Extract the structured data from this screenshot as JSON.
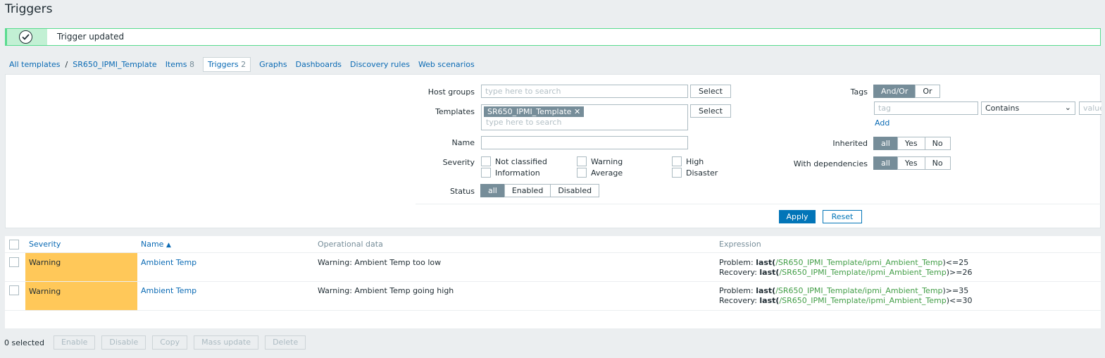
{
  "page": {
    "title": "Triggers"
  },
  "message": {
    "text": "Trigger updated"
  },
  "nav": {
    "all_templates": "All templates",
    "separator": "/",
    "template": "SR650_IPMI_Template",
    "items_label": "Items",
    "items_count": "8",
    "triggers_label": "Triggers",
    "triggers_count": "2",
    "graphs": "Graphs",
    "dashboards": "Dashboards",
    "discovery_rules": "Discovery rules",
    "web_scenarios": "Web scenarios"
  },
  "filter": {
    "host_groups_label": "Host groups",
    "host_groups_placeholder": "type here to search",
    "templates_label": "Templates",
    "templates_chip": "SR650_IPMI_Template",
    "templates_placeholder": "type here to search",
    "select_label": "Select",
    "name_label": "Name",
    "name_value": "",
    "severity_label": "Severity",
    "severities": [
      "Not classified",
      "Information",
      "Warning",
      "Average",
      "High",
      "Disaster"
    ],
    "status_label": "Status",
    "status_options": [
      "all",
      "Enabled",
      "Disabled"
    ],
    "status_selected": "all",
    "tags_label": "Tags",
    "tags_options": [
      "And/Or",
      "Or"
    ],
    "tag_placeholder": "tag",
    "tag_operator": "Contains",
    "value_placeholder": "value",
    "add_label": "Add",
    "inherited_label": "Inherited",
    "inherited_options": [
      "all",
      "Yes",
      "No"
    ],
    "dependencies_label": "With dependencies",
    "dependencies_options": [
      "all",
      "Yes",
      "No"
    ],
    "apply_label": "Apply",
    "reset_label": "Reset"
  },
  "table": {
    "headers": {
      "severity": "Severity",
      "name": "Name",
      "sort_indicator": "▲",
      "operational_data": "Operational data",
      "expression": "Expression"
    },
    "rows": [
      {
        "severity": "Warning",
        "name": "Ambient Temp",
        "operational_data": "Warning: Ambient Temp too low",
        "problem_prefix": "Problem: ",
        "problem_fn": "last(",
        "problem_item": "/SR650_IPMI_Template/ipmi_Ambient_Temp",
        "problem_suffix": ")<=25",
        "recovery_prefix": "Recovery: ",
        "recovery_fn": "last(",
        "recovery_item": "/SR650_IPMI_Template/ipmi_Ambient_Temp",
        "recovery_suffix": ")>=26"
      },
      {
        "severity": "Warning",
        "name": "Ambient Temp",
        "operational_data": "Warning: Ambient Temp going high",
        "problem_prefix": "Problem: ",
        "problem_fn": "last(",
        "problem_item": "/SR650_IPMI_Template/ipmi_Ambient_Temp",
        "problem_suffix": ")>=35",
        "recovery_prefix": "Recovery: ",
        "recovery_fn": "last(",
        "recovery_item": "/SR650_IPMI_Template/ipmi_Ambient_Temp",
        "recovery_suffix": ")<=30"
      }
    ]
  },
  "footer": {
    "selected_count": "0 selected",
    "buttons": [
      "Enable",
      "Disable",
      "Copy",
      "Mass update",
      "Delete"
    ]
  },
  "colors": {
    "warning": "#ffc859",
    "link": "#0a6ab4",
    "success_border": "#59db8f",
    "primary_button": "#0275b8",
    "toggle_selected": "#768d99"
  }
}
